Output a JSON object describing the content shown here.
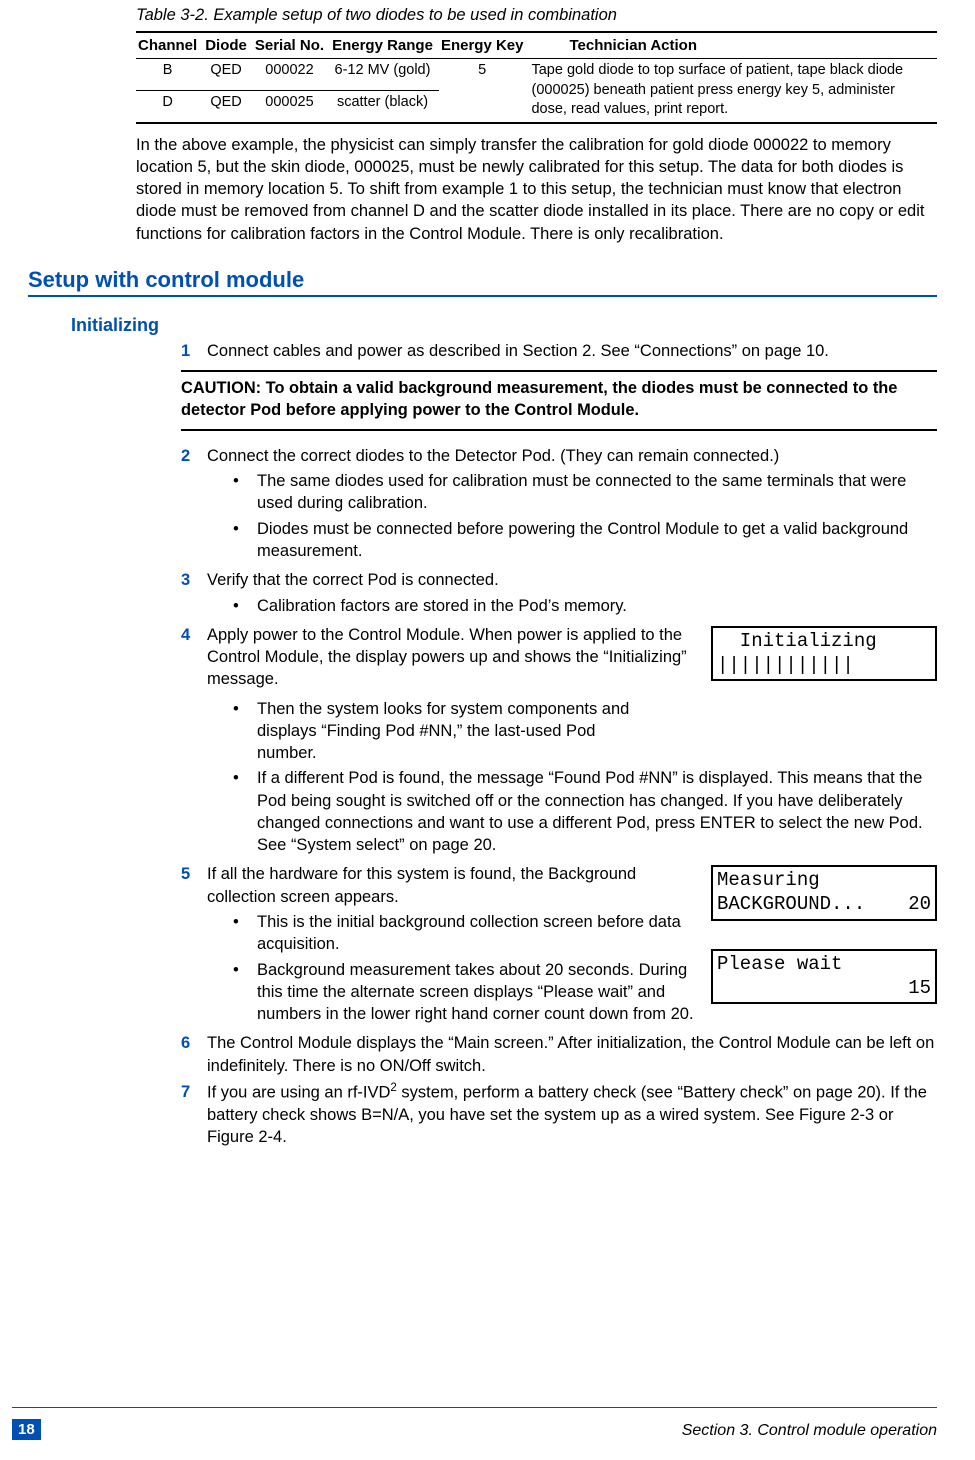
{
  "table": {
    "caption": "Table 3-2. Example setup of two diodes to be used in combination",
    "headers": [
      "Channel",
      "Diode",
      "Serial No.",
      "Energy Range",
      "Energy Key",
      "Technician Action"
    ],
    "rows": [
      {
        "channel": "B",
        "diode": "QED",
        "serial": "000022",
        "range": "6-12 MV (gold)",
        "key": "5"
      },
      {
        "channel": "D",
        "diode": "QED",
        "serial": "000025",
        "range": "scatter (black)",
        "key": ""
      }
    ],
    "action": "Tape gold diode to top surface of patient, tape black diode (000025) beneath patient press energy key 5, administer dose, read values, print report."
  },
  "intro_para": "In the above example, the physicist can simply transfer the calibration for gold diode 000022 to memory location 5, but the skin diode, 000025, must be newly calibrated for this setup. The data for both diodes is stored in memory location 5. To shift from example 1 to this setup, the techni­cian must know that electron diode must be removed from channel D and the scatter diode installed in its place. There are no copy or edit functions for calibration factors in the Control Mod­ule. There is only recalibration.",
  "heading_setup": "Setup with control module",
  "heading_init": "Initializing",
  "step1": "Connect cables and power as described in Section 2. See “Connections” on page 10.",
  "caution": "CAUTION: To obtain a valid background measurement, the diodes must be connected to the detector Pod before applying power to the Control Module.",
  "step2": "Connect the correct diodes to the Detector Pod. (They can remain connected.)",
  "step2_b1": "The same diodes used for calibration must be connected to the same terminals that were used during calibration.",
  "step2_b2": "Diodes must be connected before powering the Control Module to get a valid back­ground measurement.",
  "step3": "Verify that the correct Pod is connected.",
  "step3_b1": "Calibration factors are stored in the Pod’s memory.",
  "step4": "Apply power to the Control Module. When power is applied to the Control Module, the display powers up and shows the “Initializing” message.",
  "step4_b1": "Then the system looks for system components and dis­plays “Finding Pod #NN,” the last-used Pod number.",
  "step4_b2": "If a different Pod is found, the message “Found Pod #NN” is displayed. This means that the Pod being sought is switched off or the connection has changed. If you have deliber­ately changed connections and want to use a different Pod, press ENTER to select the new Pod. See “System select” on page 20.",
  "step5": "If all the hardware for this system is found, the Background collection screen appears.",
  "step5_b1": "This is the initial background collection screen before data acquisition.",
  "step5_b2": "Background measurement takes about 20 seconds. Dur­ing this time the alternate screen displays “Please wait” and numbers in the lower right hand corner count down from 20.",
  "step6": "The Control Module displays the “Main screen.” After initialization, the Control Module can be left on indefinitely. There is no ON/Off switch.",
  "step7_a": "If you are using an rf-IVD",
  "step7_b": " system, perform a battery check (see “Battery check” on page 20). If the battery check shows B=N/A, you have set the system up as a wired system. See Figure 2-3 or Figure 2-4.",
  "lcd_init_l1": "  Initializing",
  "lcd_init_l2": "||||||||||||",
  "lcd_meas_l1": "Measuring",
  "lcd_meas_l2a": "BACKGROUND...",
  "lcd_meas_l2b": "20",
  "lcd_wait_l1": "Please wait",
  "lcd_wait_l2": "15",
  "footer": {
    "page": "18",
    "section": "Section 3. Control module operation"
  }
}
